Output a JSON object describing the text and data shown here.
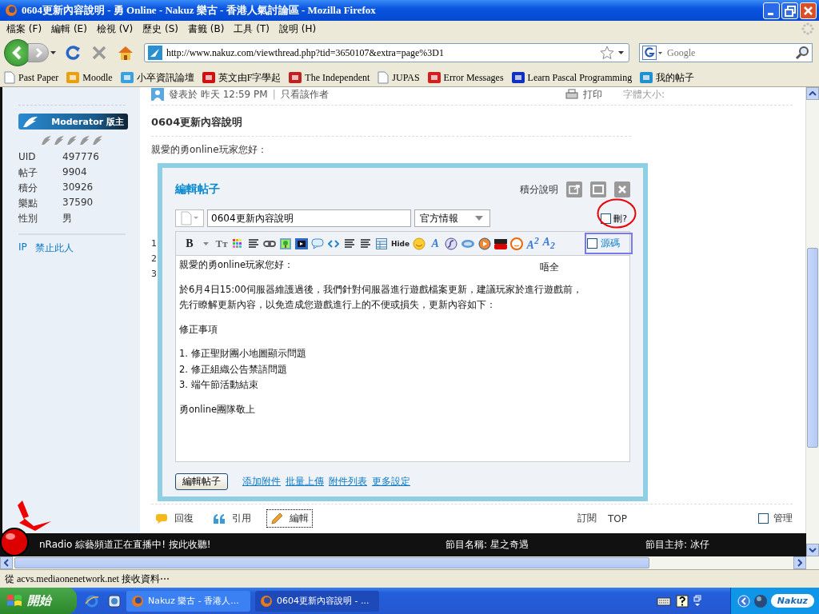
{
  "window": {
    "title": "0604更新內容說明 - 勇 Online - Nakuz 樂古 - 香港人氣討論區 - Mozilla Firefox"
  },
  "menu": [
    "檔案 (F)",
    "編輯 (E)",
    "檢視 (V)",
    "歷史 (S)",
    "書籤 (B)",
    "工具 (T)",
    "說明 (H)"
  ],
  "address": {
    "url": "http://www.nakuz.com/viewthread.php?tid=3650107&extra=page%3D1"
  },
  "search": {
    "placeholder": "Google"
  },
  "bookmarks": [
    {
      "label": "Past Paper",
      "kind": "page"
    },
    {
      "label": "Moodle",
      "kind": "moodle"
    },
    {
      "label": "小卒資訊論壇",
      "kind": "forum"
    },
    {
      "label": "英文由F字學起",
      "kind": "yahoo"
    },
    {
      "label": "The Independent",
      "kind": "eagle"
    },
    {
      "label": "JUPAS",
      "kind": "page"
    },
    {
      "label": "Error Messages",
      "kind": "error"
    },
    {
      "label": "Learn Pascal Programming",
      "kind": "lp"
    },
    {
      "label": "我的帖子",
      "kind": "nakuz"
    }
  ],
  "sidebar": {
    "badge": "Moderator 版主",
    "stars": 5,
    "stats": [
      {
        "label": "UID",
        "value": "497776"
      },
      {
        "label": "帖子",
        "value": "9904"
      },
      {
        "label": "積分",
        "value": "30926"
      },
      {
        "label": "樂點",
        "value": "37590"
      },
      {
        "label": "性別",
        "value": "男"
      }
    ],
    "links": [
      "IP",
      "禁止此人"
    ]
  },
  "post": {
    "meta": "發表於 昨天 12:59 PM",
    "author_link": "只看該作者",
    "print": "打印",
    "font_size_label": "字體大小:",
    "title": "0604更新內容說明",
    "greeting": "親愛的勇online玩家您好：",
    "separator": "|",
    "covered_line_starts": [
      "1",
      "2",
      "3"
    ],
    "actions": [
      {
        "label": "回復",
        "kind": "reply",
        "focused": false
      },
      {
        "label": "引用",
        "kind": "quote",
        "focused": false
      },
      {
        "label": "編輯",
        "kind": "edit",
        "focused": true
      }
    ],
    "subscribe": "訂閱",
    "top": "TOP",
    "manage": {
      "label": "管理",
      "checked": false
    }
  },
  "dialog": {
    "title": "編輯帖子",
    "help_link": "積分說明",
    "subject": "0604更新內容說明",
    "category": "官方情報",
    "delete_check": {
      "label": "刪?",
      "checked": false
    },
    "source_check": {
      "label": "源碼",
      "checked": false
    },
    "toolbar": [
      {
        "kind": "bold",
        "glyph": "B"
      },
      {
        "kind": "caret"
      },
      {
        "kind": "fontsize",
        "glyph": "Tт"
      },
      {
        "kind": "color"
      },
      {
        "kind": "align"
      },
      {
        "kind": "link"
      },
      {
        "kind": "image"
      },
      {
        "kind": "media"
      },
      {
        "kind": "quote"
      },
      {
        "kind": "code"
      },
      {
        "kind": "olist"
      },
      {
        "kind": "indent"
      },
      {
        "kind": "table"
      },
      {
        "kind": "hide",
        "glyph": "Hide"
      },
      {
        "kind": "smiley"
      },
      {
        "kind": "font",
        "glyph": "A"
      },
      {
        "kind": "flash"
      },
      {
        "kind": "rm"
      },
      {
        "kind": "player"
      },
      {
        "kind": "youtube"
      },
      {
        "kind": "face"
      },
      {
        "kind": "sup",
        "glyph": "A$^{2}$"
      },
      {
        "kind": "sub",
        "glyph": "A$_{2}$"
      }
    ],
    "body_paragraphs": [
      [
        "親愛的勇online玩家您好："
      ],
      [
        "於6月4日15:00伺服器維護過後，我們針對伺服器進行遊戲檔案更新，建議玩家於進行遊戲前，",
        "先行瞭解更新內容，以免造成您遊戲進行上的不便或損失，更新內容如下："
      ],
      [
        "修正事項"
      ],
      [
        "1. 修正聖財團小地圖顯示問題",
        "2. 修正組織公告禁語問題",
        "3. 端午節活動結束"
      ],
      [
        "勇online團隊敬上"
      ]
    ],
    "annotation": "唔全",
    "submit": "編輯帖子",
    "links": [
      "添加附件",
      "批量上傳",
      "附件列表",
      "更多設定"
    ]
  },
  "radio": {
    "message": "nRadio 綜藝頻道正在直播中! 按此收聽!",
    "program": "節目名稱: 星之奇遇",
    "host": "節目主持: 冰仔"
  },
  "status_bar": "從 acvs.mediaonenetwork.net 接收資料⋯",
  "taskbar": {
    "start": "開始",
    "tasks": [
      {
        "label": "Nakuz 樂古 - 香港人...",
        "selected": false
      },
      {
        "label": "0604更新內容說明 - ...",
        "selected": true
      }
    ],
    "logo": "Nakuz"
  }
}
